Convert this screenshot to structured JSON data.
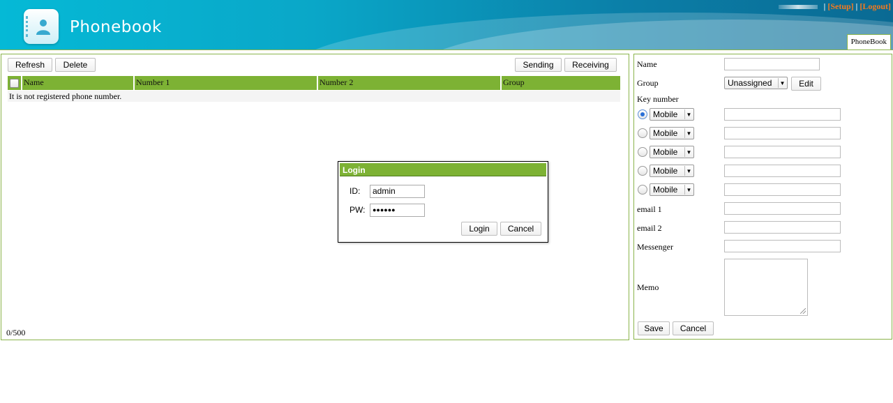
{
  "header": {
    "title": "Phonebook",
    "logo_icon": "phonebook-contact-icon",
    "setup_link": "[Setup]",
    "logout_link": "[Logout]",
    "separator": "|",
    "tab": "PhoneBook"
  },
  "toolbar": {
    "refresh": "Refresh",
    "delete": "Delete",
    "sending": "Sending",
    "receiving": "Receiving"
  },
  "table": {
    "columns": [
      "Name",
      "Number 1",
      "Number 2",
      "Group"
    ],
    "empty_message": "It is not registered phone number.",
    "count": "0/500"
  },
  "login_dialog": {
    "title": "Login",
    "id_label": "ID:",
    "id_value": "admin",
    "pw_label": "PW:",
    "pw_value": "●●●●●●",
    "login_button": "Login",
    "cancel_button": "Cancel"
  },
  "form": {
    "name_label": "Name",
    "group_label": "Group",
    "group_value": "Unassigned",
    "edit_button": "Edit",
    "key_number_label": "Key number",
    "key_numbers": [
      {
        "type": "Mobile",
        "selected": true
      },
      {
        "type": "Mobile",
        "selected": false
      },
      {
        "type": "Mobile",
        "selected": false
      },
      {
        "type": "Mobile",
        "selected": false
      },
      {
        "type": "Mobile",
        "selected": false
      }
    ],
    "email1_label": "email 1",
    "email2_label": "email 2",
    "messenger_label": "Messenger",
    "memo_label": "Memo",
    "save_button": "Save",
    "cancel_button": "Cancel"
  },
  "colors": {
    "accent_green": "#7db234",
    "header_cyan": "#05b9d6",
    "link_orange": "#f47a1f"
  }
}
